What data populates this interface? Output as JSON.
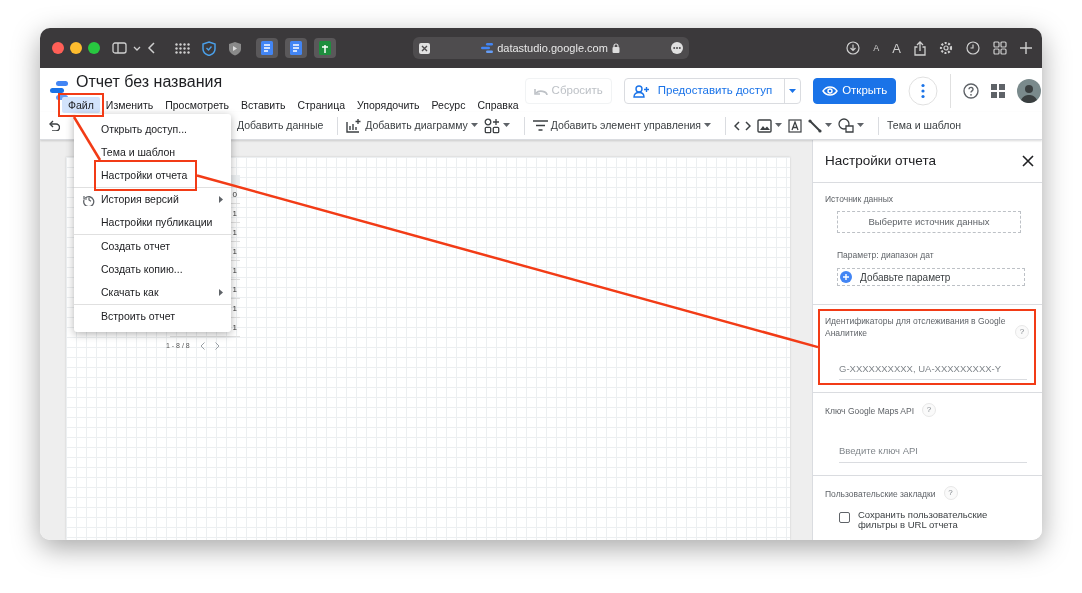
{
  "browser": {
    "pinned_tabs": [
      {
        "kind": "doc"
      },
      {
        "kind": "doc"
      },
      {
        "kind": "sheet"
      }
    ],
    "address": "datastudio.google.com",
    "text_size": [
      "A",
      "A"
    ]
  },
  "app": {
    "title": "Отчет без названия",
    "menu": [
      {
        "label": "Файл",
        "selected": true,
        "highlighted": true
      },
      {
        "label": "Изменить",
        "selected": false
      },
      {
        "label": "Просмотреть",
        "selected": false
      },
      {
        "label": "Вставить",
        "selected": false
      },
      {
        "label": "Страница",
        "selected": false
      },
      {
        "label": "Упорядочить",
        "selected": false
      },
      {
        "label": "Ресурс",
        "selected": false
      },
      {
        "label": "Справка",
        "selected": false
      }
    ],
    "reset_button": {
      "label": "Сбросить",
      "disabled": true
    },
    "share_button": {
      "label": "Предоставить доступ"
    },
    "view_button": {
      "label": "Открыть"
    }
  },
  "toolbar": [
    {
      "kind": "text",
      "label": "Добавить данные"
    },
    {
      "kind": "divider"
    },
    {
      "kind": "chart",
      "label": "Добавить диаграмму",
      "caret": true
    },
    {
      "kind": "community",
      "caret": true
    },
    {
      "kind": "divider"
    },
    {
      "kind": "control",
      "label": "Добавить элемент управления",
      "caret": true
    },
    {
      "kind": "divider"
    },
    {
      "kind": "code"
    },
    {
      "kind": "image",
      "caret": true
    },
    {
      "kind": "textbox"
    },
    {
      "kind": "line",
      "caret": true
    },
    {
      "kind": "shape",
      "caret": true
    },
    {
      "kind": "divider"
    },
    {
      "kind": "text",
      "label": "Тема и шаблон"
    }
  ],
  "file_menu": [
    {
      "kind": "item",
      "label": "Открыть доступ...",
      "highlighted": false
    },
    {
      "kind": "item",
      "label": "Тема и шаблон",
      "highlighted": false
    },
    {
      "kind": "item",
      "label": "Настройки отчета",
      "highlighted": true
    },
    {
      "kind": "divider"
    },
    {
      "kind": "history",
      "label": "История версий",
      "submenu": true,
      "highlighted": false
    },
    {
      "kind": "item",
      "label": "Настройки публикации",
      "highlighted": false
    },
    {
      "kind": "divider"
    },
    {
      "kind": "item",
      "label": "Создать отчет",
      "highlighted": false
    },
    {
      "kind": "item",
      "label": "Создать копию...",
      "highlighted": false
    },
    {
      "kind": "item",
      "label": "Скачать как",
      "submenu": true,
      "highlighted": false
    },
    {
      "kind": "divider"
    },
    {
      "kind": "item",
      "label": "Встроить отчет",
      "highlighted": false
    }
  ],
  "canvas_table": {
    "values": [
      "0",
      "1",
      "1",
      "1",
      "1",
      "1",
      "1",
      "1"
    ],
    "pagination": "1 - 8 / 8"
  },
  "panel": {
    "title": "Настройки отчета",
    "sections": [
      {
        "kind": "source",
        "label": "Источник данных",
        "button": "Выберите источник данных",
        "param_label": "Параметр: диапазон дат",
        "param_button": "Добавьте параметр",
        "highlighted": false
      },
      {
        "kind": "input",
        "label": "Идентификаторы для отслеживания в Google Аналитике",
        "help": "?",
        "placeholder": "G-XXXXXXXXXX, UA-XXXXXXXXX-Y",
        "highlighted": true
      },
      {
        "kind": "input",
        "label": "Ключ Google Maps API",
        "help": "?",
        "placeholder": "Введите ключ API",
        "highlighted": false
      },
      {
        "kind": "checkbox",
        "label": "Пользовательские закладки",
        "help": "?",
        "option": "Сохранить пользовательские фильтры в URL отчета",
        "checked": false,
        "highlighted": false
      }
    ]
  }
}
